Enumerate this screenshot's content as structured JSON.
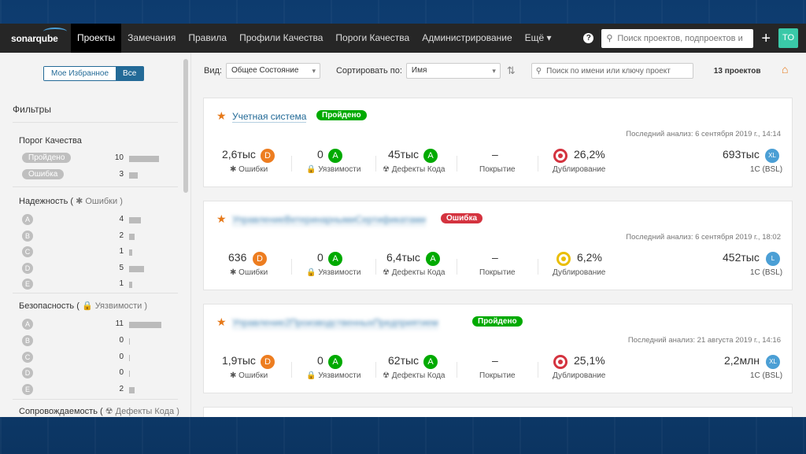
{
  "nav": {
    "logo": "sonarqube",
    "items": [
      "Проекты",
      "Замечания",
      "Правила",
      "Профили Качества",
      "Пороги Качества",
      "Администрирование",
      "Ещё ▾"
    ],
    "search_placeholder": "Поиск проектов, подпроектов и",
    "avatar": "TO"
  },
  "sidebar": {
    "toggle": [
      "Мое Избранное",
      "Все"
    ],
    "filters_title": "Фильтры",
    "quality_gate": {
      "title": "Порог Качества",
      "rows": [
        {
          "label": "Пройдено",
          "count": "10"
        },
        {
          "label": "Ошибка",
          "count": "3"
        }
      ]
    },
    "reliability": {
      "title": "Надежность (",
      "sub": "Ошибки )",
      "rows": [
        {
          "label": "A",
          "count": "4"
        },
        {
          "label": "B",
          "count": "2"
        },
        {
          "label": "C",
          "count": "1"
        },
        {
          "label": "D",
          "count": "5"
        },
        {
          "label": "E",
          "count": "1"
        }
      ]
    },
    "security": {
      "title": "Безопасность (",
      "sub": "Уязвимости )",
      "rows": [
        {
          "label": "A",
          "count": "11"
        },
        {
          "label": "B",
          "count": "0"
        },
        {
          "label": "C",
          "count": "0"
        },
        {
          "label": "D",
          "count": "0"
        },
        {
          "label": "E",
          "count": "2"
        }
      ]
    },
    "maintainability": {
      "title": "Сопровождаемость (",
      "sub": "Дефекты Кода )"
    }
  },
  "toolbar": {
    "view_label": "Вид:",
    "view_value": "Общее Состояние",
    "sort_label": "Сортировать по:",
    "sort_value": "Имя",
    "search_placeholder": "Поиск по имени или ключу проект",
    "count": "13 проектов"
  },
  "labels": {
    "bugs": "Ошибки",
    "vulns": "Уязвимости",
    "smells": "Дефекты Кода",
    "coverage": "Покрытие",
    "dup": "Дублирование"
  },
  "projects": [
    {
      "name": "Учетная система",
      "status": "Пройдено",
      "analysis": "Последний анализ: 6 сентября 2019 г., 14:14",
      "bugs": "2,6тыс",
      "bugs_rating": "D",
      "vulns": "0",
      "vulns_rating": "A",
      "smells": "45тыс",
      "smells_rating": "A",
      "coverage": "–",
      "dup": "26,2%",
      "size": "693тыс",
      "size_rating": "XL",
      "lang": "1С (BSL)"
    },
    {
      "name": "УправлениеВетеринарнымиСертификатами",
      "status": "Ошибка",
      "analysis": "Последний анализ: 6 сентября 2019 г., 18:02",
      "bugs": "636",
      "bugs_rating": "D",
      "vulns": "0",
      "vulns_rating": "A",
      "smells": "6,4тыс",
      "smells_rating": "A",
      "coverage": "–",
      "dup": "6,2%",
      "size": "452тыс",
      "size_rating": "L",
      "lang": "1С (BSL)"
    },
    {
      "name": "Управление2ПроизводственныхПредприятием",
      "status": "Пройдено",
      "analysis": "Последний анализ: 21 августа 2019 г., 14:16",
      "bugs": "1,9тыс",
      "bugs_rating": "D",
      "vulns": "0",
      "vulns_rating": "A",
      "smells": "62тыс",
      "smells_rating": "A",
      "coverage": "–",
      "dup": "25,1%",
      "size": "2,2млн",
      "size_rating": "XL",
      "lang": "1С (BSL)"
    }
  ]
}
